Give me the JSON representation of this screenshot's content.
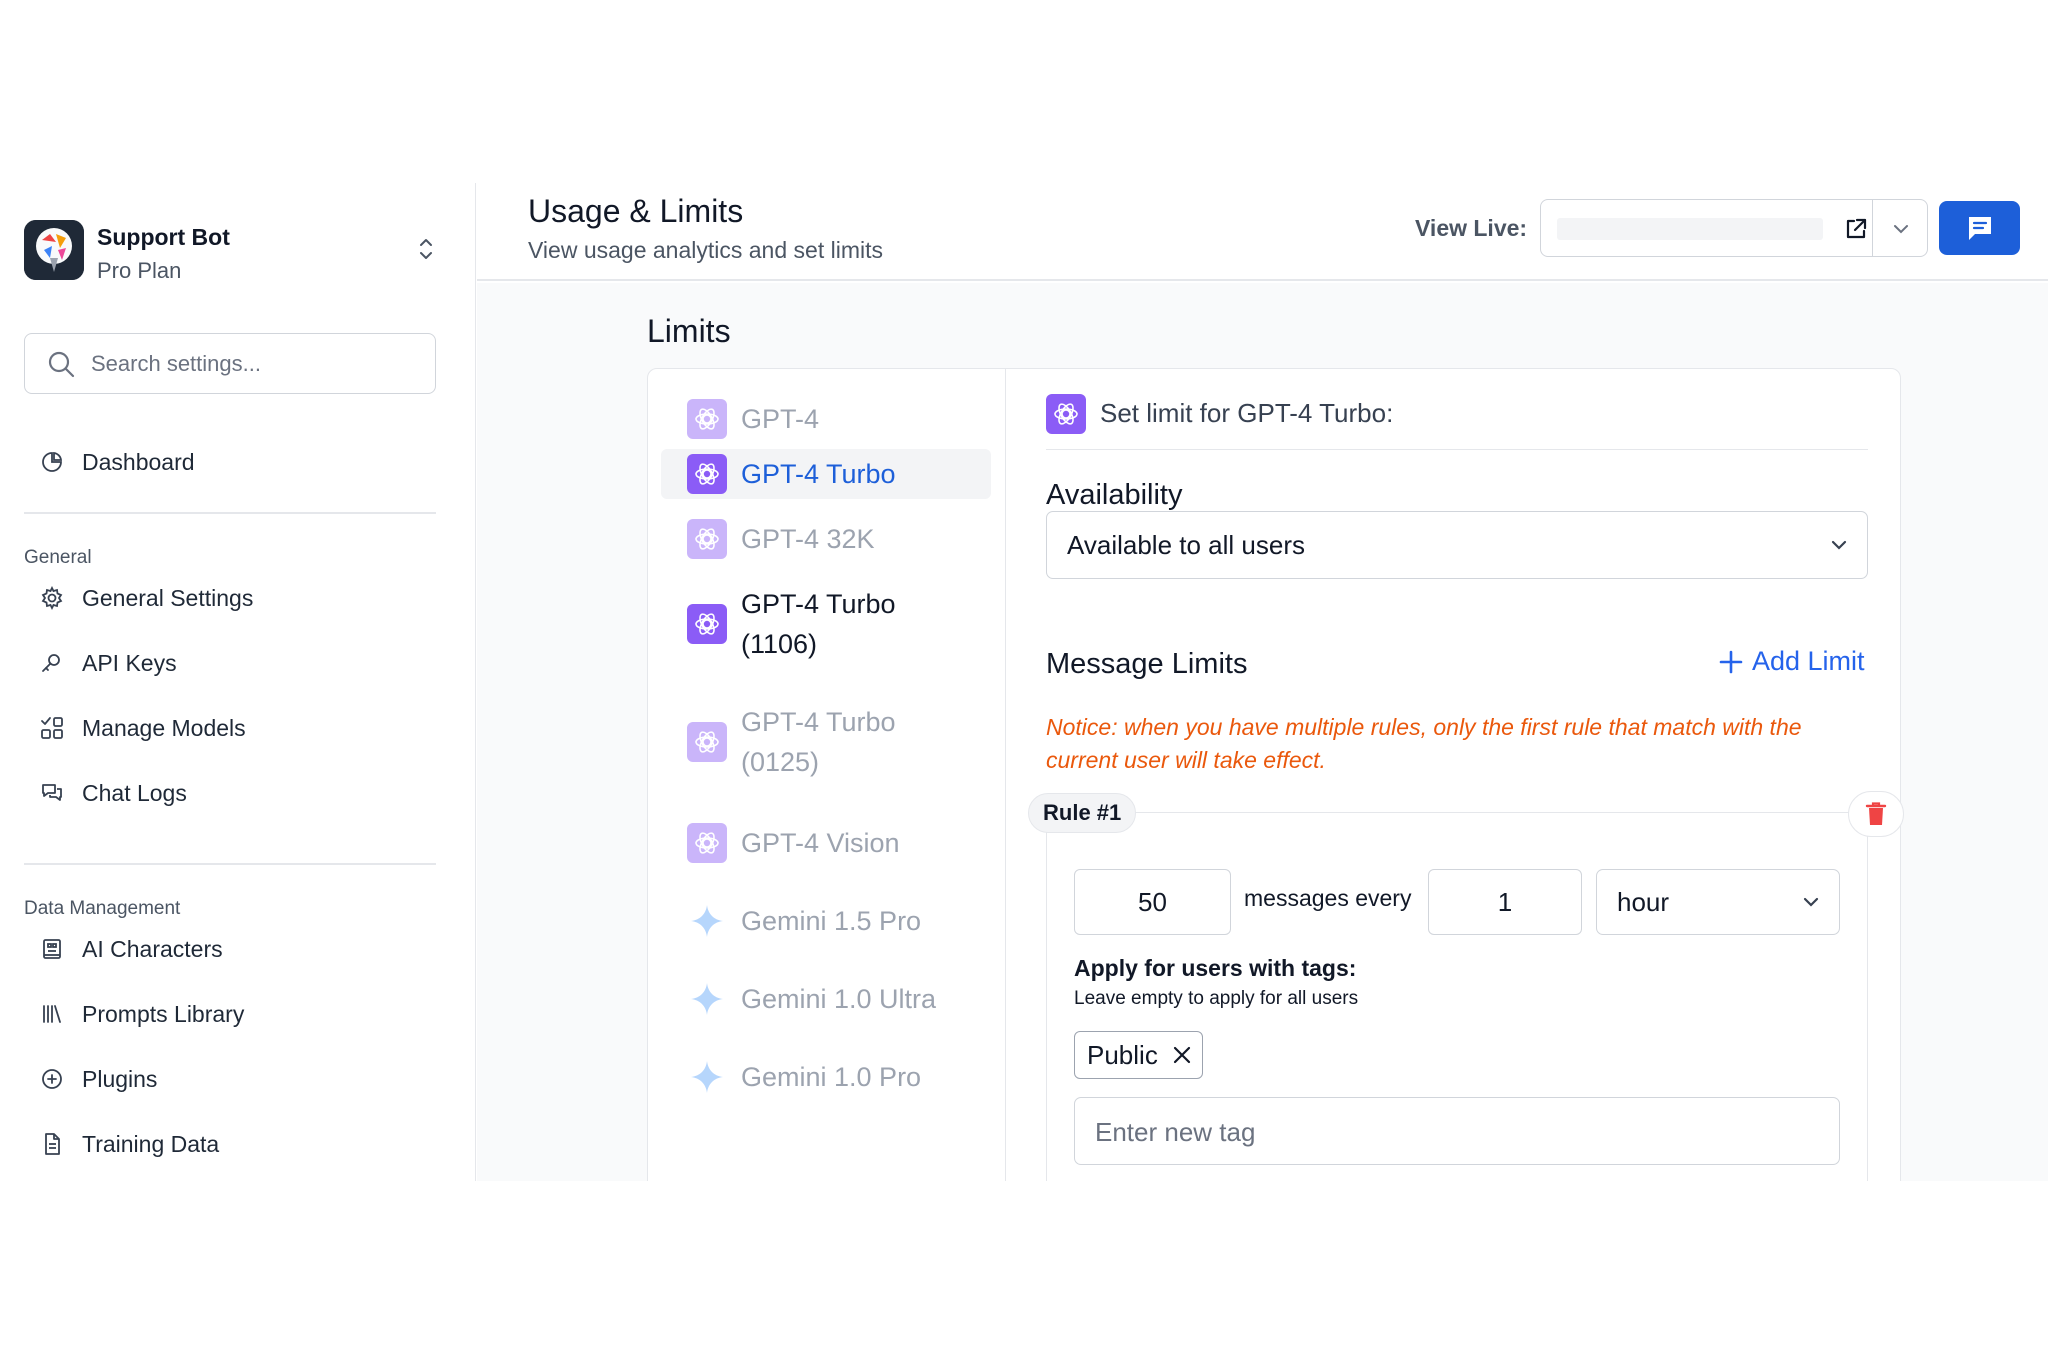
{
  "bot": {
    "name": "Support Bot",
    "plan": "Pro Plan"
  },
  "search": {
    "placeholder": "Search settings..."
  },
  "nav": {
    "dashboard": "Dashboard",
    "general_label": "General",
    "general_items": [
      "General Settings",
      "API Keys",
      "Manage Models",
      "Chat Logs"
    ],
    "data_label": "Data Management",
    "data_items": [
      "AI Characters",
      "Prompts Library",
      "Plugins",
      "Training Data"
    ]
  },
  "header": {
    "title": "Usage & Limits",
    "subtitle": "View usage analytics and set limits",
    "view_live_label": "View Live:"
  },
  "limits": {
    "section_title": "Limits",
    "models": [
      {
        "label": "GPT-4",
        "icon": "openai-icon",
        "state": "dim"
      },
      {
        "label": "GPT-4 Turbo",
        "icon": "openai-icon",
        "state": "active"
      },
      {
        "label": "GPT-4 32K",
        "icon": "openai-icon",
        "state": "dim"
      },
      {
        "label_line1": "GPT-4 Turbo",
        "label_line2": "(1106)",
        "icon": "openai-icon",
        "state": "normal"
      },
      {
        "label_line1": "GPT-4 Turbo",
        "label_line2": "(0125)",
        "icon": "openai-icon",
        "state": "dim"
      },
      {
        "label": "GPT-4 Vision",
        "icon": "openai-icon",
        "state": "dim"
      },
      {
        "label": "Gemini 1.5 Pro",
        "icon": "gemini-icon",
        "state": "dim"
      },
      {
        "label": "Gemini 1.0 Ultra",
        "icon": "gemini-icon",
        "state": "dim"
      },
      {
        "label": "Gemini 1.0 Pro",
        "icon": "gemini-icon",
        "state": "dim"
      }
    ],
    "set_limit_title": "Set limit for GPT-4 Turbo:",
    "availability_title": "Availability",
    "availability_value": "Available to all users",
    "message_limits_title": "Message Limits",
    "add_limit_label": "Add Limit",
    "notice": "Notice: when you have multiple rules, only the first rule that match with the current user will take effect.",
    "rule": {
      "badge": "Rule #1",
      "messages": "50",
      "messages_every_label": "messages every",
      "period_count": "1",
      "period_unit": "hour",
      "apply_title": "Apply for users with tags:",
      "apply_subtitle": "Leave empty to apply for all users",
      "tags": [
        "Public"
      ],
      "new_tag_placeholder": "Enter new tag"
    }
  },
  "colors": {
    "accent": "#1d5fd9",
    "link": "#2563eb",
    "notice": "#ea580c",
    "delete": "#ef4444",
    "openai_icon_bg": "#8b5cf6"
  }
}
